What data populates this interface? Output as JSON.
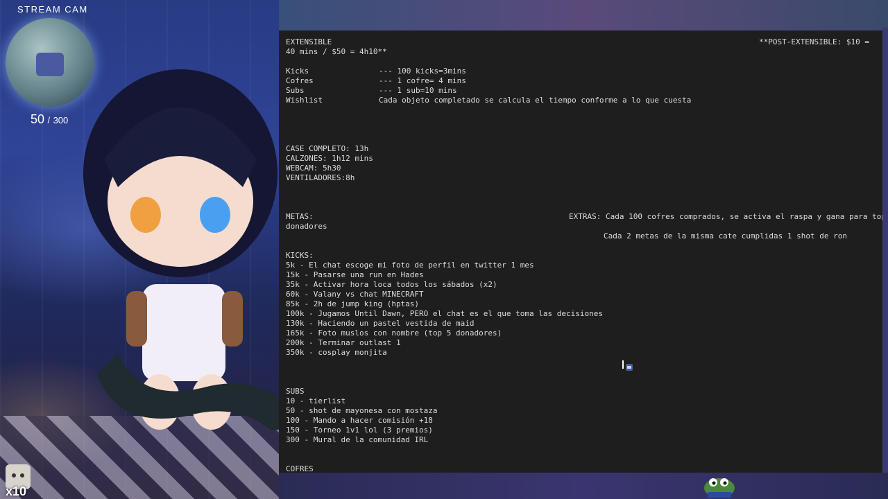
{
  "overlay": {
    "stream_cam_label": "STREAM CAM",
    "counter_current": "50",
    "counter_sep": "/",
    "counter_max": "300",
    "badge_multiplier": "x10"
  },
  "document": {
    "header_left": "EXTENSIBLE",
    "header_right": "**POST-EXTENSIBLE: $10 =",
    "price_line": "40 mins / $50 = 4h10**",
    "rates": [
      {
        "label": "Kicks",
        "value": "--- 100 kicks=3mins"
      },
      {
        "label": "Cofres",
        "value": "--- 1 cofre= 4 mins"
      },
      {
        "label": "Subs",
        "value": "--- 1 sub=10 mins"
      },
      {
        "label": "Wishlist",
        "value": "Cada objeto completado se calcula el tiempo conforme a lo que cuesta"
      }
    ],
    "wishlist_items": [
      "CASE COMPLETO: 13h",
      "CALZONES: 1h12 mins",
      "WEBCAM: 5h30",
      "VENTILADORES:8h"
    ],
    "metas_label": "METAS:",
    "extras_line1": "EXTRAS: Cada 100 cofres comprados, se activa el raspa y gana para top",
    "extras_wrap": "donadores",
    "extras_line2": "Cada 2 metas de la misma cate cumplidas 1 shot de ron",
    "kicks_header": "KICKS:",
    "kicks_goals": [
      "5k - El chat escoge mi foto de perfil en twitter 1 mes",
      "15k - Pasarse una run en Hades",
      "35k - Activar hora loca todos los sábados (x2)",
      "60k - Valany vs chat MINECRAFT",
      "85k - 2h de jump king (hptas)",
      "100k - Jugamos Until Dawn, PERO el chat es el que toma las decisiones",
      "130k - Haciendo un pastel vestida de maid",
      "165k - Foto muslos con nombre (top 5 donadores)",
      "200k - Terminar outlast 1",
      "350k - cosplay monjita"
    ],
    "subs_header": "SUBS",
    "subs_goals": [
      "10 - tierlist",
      "50 - shot de mayonesa con mostaza",
      "100 - Mando a hacer comisión +18",
      "150 - Torneo 1v1 lol (3 premios)",
      "300 - Mural de la comunidad IRL"
    ],
    "cofres_header": "COFRES"
  },
  "colors": {
    "terminal_bg": "#1e1e1e",
    "terminal_text": "#dcdcdc",
    "spellcheck_underline": "#ff3b3b"
  }
}
